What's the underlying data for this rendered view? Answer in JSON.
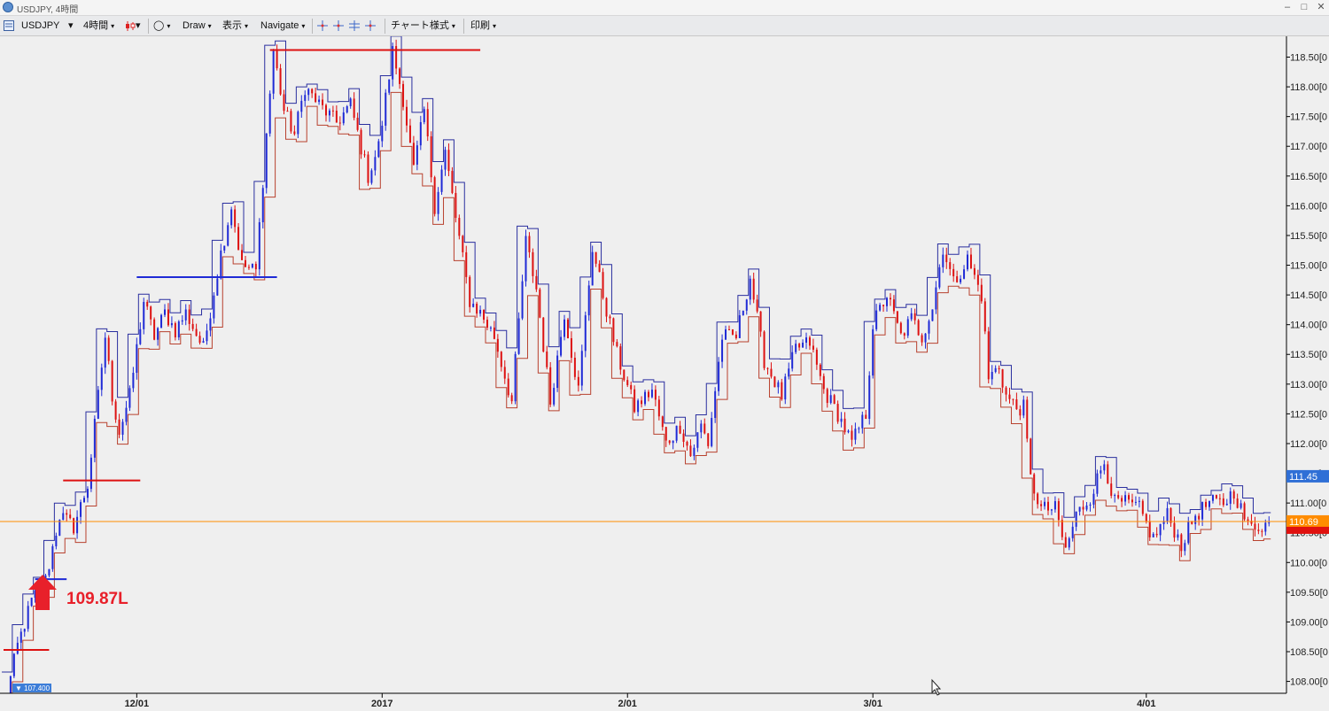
{
  "window": {
    "title": "USDJPY, 4時間",
    "minimize_glyph": "–",
    "maximize_glyph": "□",
    "close_glyph": "✕"
  },
  "toolbar": {
    "symbol": "USDJPY",
    "timeframe": "4時間",
    "draw_label": "Draw",
    "display_label": "表示",
    "navigate_label": "Navigate",
    "chart_style_label": "チャート様式",
    "print_label": "印刷",
    "dropdown_glyph": "▾",
    "circle_glyph": "◯"
  },
  "chart_data": {
    "type": "candlestick",
    "symbol": "USDJPY",
    "timeframe": "4時間",
    "ylim": [
      107.8,
      118.85
    ],
    "y_ticks": [
      108.0,
      108.5,
      109.0,
      109.5,
      110.0,
      110.5,
      111.0,
      111.5,
      112.0,
      112.5,
      113.0,
      113.5,
      114.0,
      114.5,
      115.0,
      115.5,
      116.0,
      116.5,
      117.0,
      117.5,
      118.0,
      118.5
    ],
    "y_tick_labels": [
      "108.00[0",
      "108.50[0",
      "109.00[0",
      "109.50[0",
      "110.00[0",
      "110.50[0",
      "111.00[0",
      "111.50[0",
      "112.00[0",
      "112.50[0",
      "113.00[0",
      "113.50[0",
      "114.00[0",
      "114.50[0",
      "115.00[0",
      "115.50[0",
      "116.00[0",
      "116.50[0",
      "117.00[0",
      "117.50[0",
      "118.00[0",
      "118.50[0"
    ],
    "x_labels": [
      "12/01",
      "2017",
      "2/01",
      "3/01",
      "4/01"
    ],
    "x_label_bars": [
      38,
      108,
      178,
      248,
      326
    ],
    "bar_count": 362,
    "path_keypoints": [
      [
        0,
        107.5
      ],
      [
        4,
        108.6
      ],
      [
        8,
        109.35
      ],
      [
        12,
        109.7
      ],
      [
        16,
        110.8
      ],
      [
        20,
        110.6
      ],
      [
        24,
        111.3
      ],
      [
        26,
        112.3
      ],
      [
        29,
        113.8
      ],
      [
        31,
        112.8
      ],
      [
        33,
        112.2
      ],
      [
        36,
        112.8
      ],
      [
        40,
        114.4
      ],
      [
        43,
        113.8
      ],
      [
        46,
        114.2
      ],
      [
        49,
        113.9
      ],
      [
        52,
        114.2
      ],
      [
        57,
        113.6
      ],
      [
        62,
        115.2
      ],
      [
        65,
        116.0
      ],
      [
        68,
        115.0
      ],
      [
        72,
        114.9
      ],
      [
        75,
        117.2
      ],
      [
        77,
        118.6
      ],
      [
        80,
        117.6
      ],
      [
        83,
        117.2
      ],
      [
        86,
        118.0
      ],
      [
        90,
        117.7
      ],
      [
        95,
        117.4
      ],
      [
        99,
        117.7
      ],
      [
        104,
        116.5
      ],
      [
        107,
        117.0
      ],
      [
        111,
        118.6
      ],
      [
        114,
        117.8
      ],
      [
        117,
        116.6
      ],
      [
        120,
        117.6
      ],
      [
        123,
        116.0
      ],
      [
        126,
        116.9
      ],
      [
        129,
        115.8
      ],
      [
        133,
        114.4
      ],
      [
        136,
        114.2
      ],
      [
        140,
        113.8
      ],
      [
        145,
        112.7
      ],
      [
        149,
        115.4
      ],
      [
        152,
        114.6
      ],
      [
        156,
        112.7
      ],
      [
        160,
        114.2
      ],
      [
        164,
        112.9
      ],
      [
        168,
        115.3
      ],
      [
        171,
        114.5
      ],
      [
        175,
        113.5
      ],
      [
        180,
        112.6
      ],
      [
        185,
        112.9
      ],
      [
        189,
        112.0
      ],
      [
        193,
        112.3
      ],
      [
        196,
        111.8
      ],
      [
        199,
        112.3
      ],
      [
        201,
        112.0
      ],
      [
        205,
        113.8
      ],
      [
        209,
        113.8
      ],
      [
        213,
        114.8
      ],
      [
        217,
        113.4
      ],
      [
        222,
        112.8
      ],
      [
        226,
        113.6
      ],
      [
        230,
        113.7
      ],
      [
        234,
        112.9
      ],
      [
        238,
        112.5
      ],
      [
        242,
        112.0
      ],
      [
        246,
        112.5
      ],
      [
        248,
        114.0
      ],
      [
        252,
        114.5
      ],
      [
        256,
        113.8
      ],
      [
        259,
        114.1
      ],
      [
        262,
        113.8
      ],
      [
        265,
        114.3
      ],
      [
        268,
        115.3
      ],
      [
        271,
        114.7
      ],
      [
        275,
        115.1
      ],
      [
        279,
        114.5
      ],
      [
        281,
        113.1
      ],
      [
        284,
        113.3
      ],
      [
        286,
        112.8
      ],
      [
        289,
        112.6
      ],
      [
        291,
        112.6
      ],
      [
        293,
        111.4
      ],
      [
        296,
        110.9
      ],
      [
        300,
        110.9
      ],
      [
        303,
        110.2
      ],
      [
        306,
        110.8
      ],
      [
        310,
        111.1
      ],
      [
        314,
        111.7
      ],
      [
        317,
        111.0
      ],
      [
        320,
        111.0
      ],
      [
        324,
        110.9
      ],
      [
        328,
        110.4
      ],
      [
        332,
        110.8
      ],
      [
        336,
        110.3
      ],
      [
        340,
        110.8
      ],
      [
        344,
        111.0
      ],
      [
        348,
        111.0
      ],
      [
        351,
        111.2
      ],
      [
        355,
        110.6
      ]
    ],
    "last_bid": 111.45,
    "current_price": 110.69,
    "lowest_marker_label": "107.400",
    "annotation": "109.87L",
    "horizontal_segments": [
      {
        "color": "#dd1111",
        "price": 108.53,
        "from_bar": 0,
        "to_bar": 13
      },
      {
        "color": "#1f2ad6",
        "price": 109.72,
        "from_bar": 9,
        "to_bar": 18
      },
      {
        "color": "#dd1111",
        "price": 111.38,
        "from_bar": 17,
        "to_bar": 39
      },
      {
        "color": "#1f2ad6",
        "price": 114.8,
        "from_bar": 38,
        "to_bar": 78
      },
      {
        "color": "#dd1111",
        "price": 118.62,
        "from_bar": 76,
        "to_bar": 136
      }
    ],
    "colors": {
      "up_candle": "#1f2ad6",
      "down_candle": "#dd1111",
      "channel_upper": "#2a2f9f",
      "channel_lower": "#b8412e",
      "current_price_line": "#ff8c00",
      "bid_box": "#2f6fd6",
      "price_box": "#ff8c00",
      "annotation": "#e8202a"
    }
  }
}
